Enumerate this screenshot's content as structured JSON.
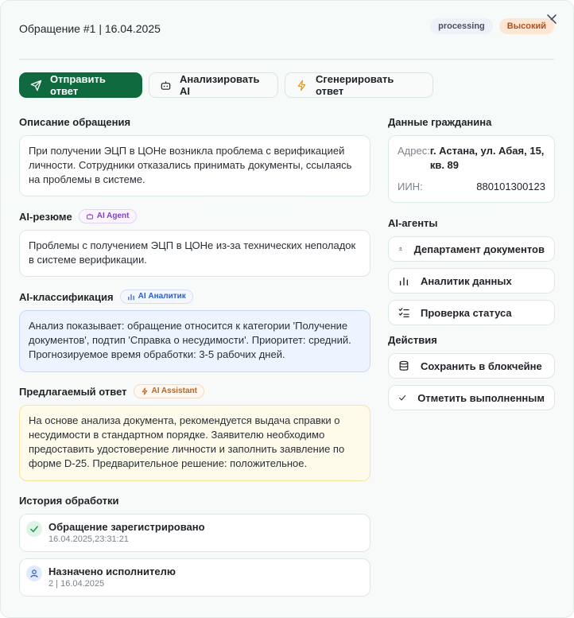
{
  "header": {
    "title": "Обращение #1 | 16.04.2025",
    "status_badge": "processing",
    "priority_badge": "Высокий"
  },
  "toolbar": {
    "send_label": "Отправить ответ",
    "analyze_label": "Анализировать AI",
    "generate_label": "Сгенерировать ответ"
  },
  "description": {
    "title": "Описание обращения",
    "text": "При получении ЭЦП в ЦОНе возникла проблема с верификацией личности. Сотрудники отказались принимать документы, ссылаясь на проблемы в системе."
  },
  "ai_summary": {
    "title": "AI-резюме",
    "tag": "AI Agent",
    "text": "Проблемы с получением ЭЦП в ЦОНе из-за технических неполадок в системе верификации."
  },
  "ai_classification": {
    "title": "AI-классификация",
    "tag": "AI Аналитик",
    "text": "Анализ показывает: обращение относится к категории 'Получение документов', подтип 'Справка о несудимости'. Приоритет: средний. Прогнозируемое время обработки: 3-5 рабочих дней."
  },
  "suggested_answer": {
    "title": "Предлагаемый ответ",
    "tag": "AI Assistant",
    "text": "На основе анализа документа, рекомендуется выдача справки о несудимости в стандартном порядке. Заявителю необходимо предоставить удостоверение личности и заполнить заявление по форме D-25. Предварительное решение: положительное."
  },
  "history": {
    "title": "История обработки",
    "items": [
      {
        "title": "Обращение зарегистрировано",
        "sub": "16.04.2025,23:31:21"
      },
      {
        "title": "Назначено исполнителю",
        "sub": "2 | 16.04.2025"
      }
    ]
  },
  "citizen": {
    "title": "Данные гражданина",
    "address_label": "Адрес:",
    "address_value": "г. Астана, ул. Абая, 15, кв. 89",
    "iin_label": "ИИН:",
    "iin_value": "880101300123"
  },
  "agents": {
    "title": "AI-агенты",
    "items": [
      "Департамент документов",
      "Аналитик данных",
      "Проверка статуса"
    ]
  },
  "actions": {
    "title": "Действия",
    "items": [
      "Сохранить в блокчейне",
      "Отметить выполненным"
    ]
  },
  "colors": {
    "primary": "#0f6b3f",
    "priority_bg": "#fde6d4",
    "classification_bg": "#eef4ff",
    "answer_bg": "#fffbeb"
  }
}
